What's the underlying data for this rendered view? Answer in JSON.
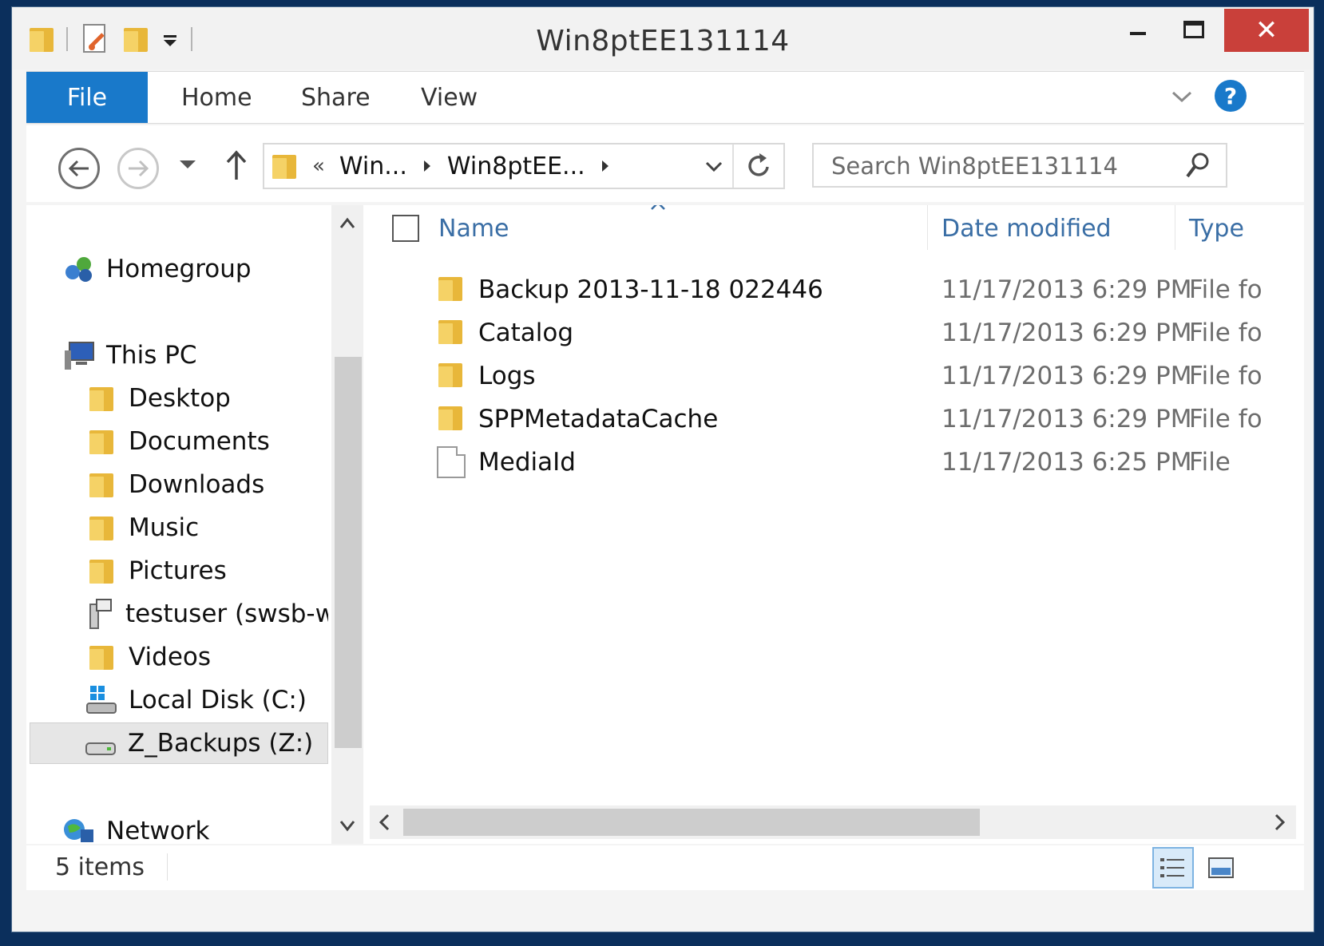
{
  "window": {
    "title": "Win8ptEE131114",
    "close_glyph": "✕"
  },
  "ribbon": {
    "tabs": [
      {
        "label": "File"
      },
      {
        "label": "Home"
      },
      {
        "label": "Share"
      },
      {
        "label": "View"
      }
    ],
    "help_glyph": "?"
  },
  "address": {
    "overflow_glyph": "«",
    "crumbs": [
      "Win...",
      "Win8ptEE..."
    ],
    "search_placeholder": "Search Win8ptEE131114"
  },
  "nav_pane": {
    "items": [
      {
        "label": "Homegroup",
        "icon": "homegroup-icon"
      },
      {
        "label": "This PC",
        "icon": "computer-icon"
      },
      {
        "label": "Desktop",
        "icon": "desktop-folder-icon"
      },
      {
        "label": "Documents",
        "icon": "documents-folder-icon"
      },
      {
        "label": "Downloads",
        "icon": "downloads-folder-icon"
      },
      {
        "label": "Music",
        "icon": "music-folder-icon"
      },
      {
        "label": "Pictures",
        "icon": "pictures-folder-icon"
      },
      {
        "label": "testuser (swsb-w",
        "icon": "network-drive-icon"
      },
      {
        "label": "Videos",
        "icon": "videos-folder-icon"
      },
      {
        "label": "Local Disk (C:)",
        "icon": "local-disk-icon"
      },
      {
        "label": "Z_Backups (Z:)",
        "icon": "drive-icon",
        "selected": true
      },
      {
        "label": "Network",
        "icon": "network-icon"
      }
    ]
  },
  "file_list": {
    "columns": {
      "name": "Name",
      "date": "Date modified",
      "type": "Type"
    },
    "rows": [
      {
        "name": "Backup 2013-11-18 022446",
        "date": "11/17/2013 6:29 PM",
        "type": "File fo",
        "kind": "folder"
      },
      {
        "name": "Catalog",
        "date": "11/17/2013 6:29 PM",
        "type": "File fo",
        "kind": "folder"
      },
      {
        "name": "Logs",
        "date": "11/17/2013 6:29 PM",
        "type": "File fo",
        "kind": "folder"
      },
      {
        "name": "SPPMetadataCache",
        "date": "11/17/2013 6:29 PM",
        "type": "File fo",
        "kind": "folder"
      },
      {
        "name": "MediaId",
        "date": "11/17/2013 6:25 PM",
        "type": "File",
        "kind": "file"
      }
    ]
  },
  "status": {
    "item_count": "5 items"
  },
  "colors": {
    "accent": "#1979ca",
    "close": "#c9403a",
    "header_text": "#3a6ea5",
    "folder": "#e8b73a"
  }
}
